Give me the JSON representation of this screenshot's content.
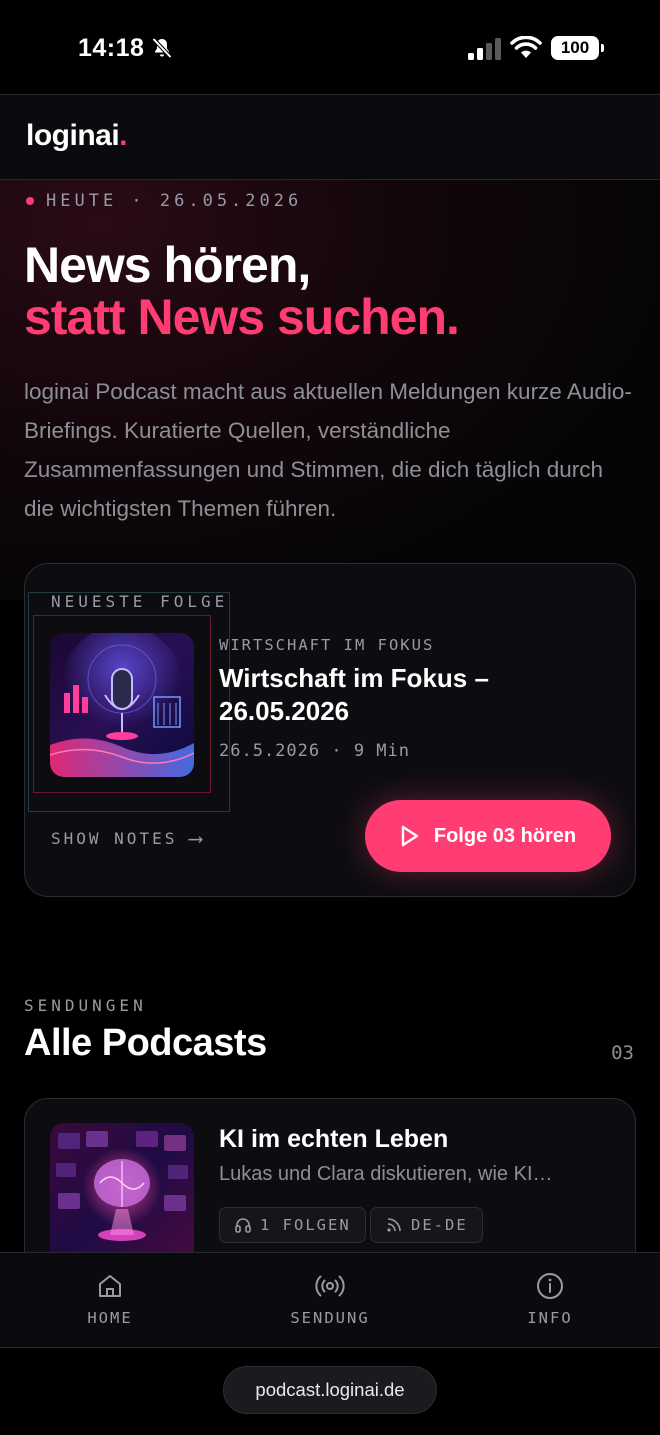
{
  "status_bar": {
    "time": "14:18",
    "battery": "100",
    "icons": [
      "bell-slash-icon",
      "signal-icon",
      "wifi-icon",
      "battery-icon"
    ]
  },
  "header": {
    "logo_text": "loginai",
    "logo_dot": "."
  },
  "hero": {
    "date_line": "HEUTE · 26.05.2026",
    "headline_1": "News hören,",
    "headline_2": "statt News suchen.",
    "intro": "loginai Podcast macht aus aktuellen Meldungen kurze Audio-Briefings. Kuratierte Quellen, verständliche Zusammenfassungen und Stimmen, die dich täglich durch die wichtigsten Themen führen."
  },
  "latest_episode": {
    "label": "NEUESTE FOLGE",
    "category": "WIRTSCHAFT IM FOKUS",
    "title": "Wirtschaft im Fokus – 26.05.2026",
    "meta": "26.5.2026 · 9 Min",
    "show_notes": "SHOW NOTES",
    "play_label": "Folge 03 hören"
  },
  "section": {
    "label": "SENDUNGEN",
    "title": "Alle Podcasts",
    "count": "03"
  },
  "podcasts": [
    {
      "title": "KI im echten Leben",
      "description": "Lukas und Clara diskutieren, wie KI…",
      "episodes_chip": "1 FOLGEN",
      "language_chip": "DE-DE"
    }
  ],
  "bottom_nav": {
    "items": [
      {
        "label": "HOME",
        "icon": "home-icon"
      },
      {
        "label": "SENDUNG",
        "icon": "broadcast-icon"
      },
      {
        "label": "INFO",
        "icon": "info-icon"
      }
    ]
  },
  "browser": {
    "url": "podcast.loginai.de"
  },
  "colors": {
    "accent": "#ff3d73",
    "background": "#000000",
    "card": "#0d0d11",
    "muted_text": "#8e8e98"
  }
}
